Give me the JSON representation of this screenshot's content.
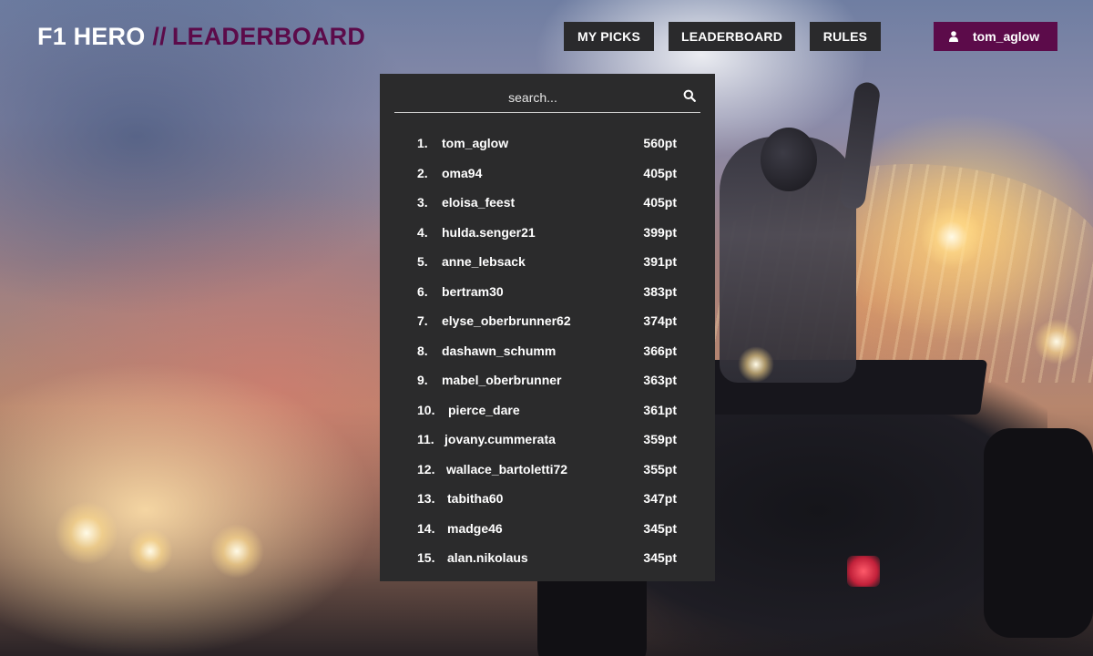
{
  "header": {
    "brand": "F1 HERO",
    "separator": "//",
    "page_title": "LEADERBOARD"
  },
  "nav": {
    "my_picks": "MY PICKS",
    "leaderboard": "LEADERBOARD",
    "rules": "RULES"
  },
  "user": {
    "icon": "user-icon",
    "name": "tom_aglow"
  },
  "colors": {
    "accent": "#5c0b4a",
    "panel": "#2b2b2c",
    "nav_button": "#2a2a2c"
  },
  "search": {
    "placeholder": "search...",
    "icon": "search-icon"
  },
  "leaderboard": {
    "entries": [
      {
        "rank": "1.",
        "name": "tom_aglow",
        "points": "560pt"
      },
      {
        "rank": "2.",
        "name": "oma94",
        "points": "405pt"
      },
      {
        "rank": "3.",
        "name": "eloisa_feest",
        "points": "405pt"
      },
      {
        "rank": "4.",
        "name": "hulda.senger21",
        "points": "399pt"
      },
      {
        "rank": "5.",
        "name": "anne_lebsack",
        "points": "391pt"
      },
      {
        "rank": "6.",
        "name": "bertram30",
        "points": "383pt"
      },
      {
        "rank": "7.",
        "name": "elyse_oberbrunner62",
        "points": "374pt"
      },
      {
        "rank": "8.",
        "name": "dashawn_schumm",
        "points": "366pt"
      },
      {
        "rank": "9.",
        "name": "mabel_oberbrunner",
        "points": "363pt"
      },
      {
        "rank": "10.",
        "name": "pierce_dare",
        "points": "361pt"
      },
      {
        "rank": "11.",
        "name": "jovany.cummerata",
        "points": "359pt"
      },
      {
        "rank": "12.",
        "name": "wallace_bartoletti72",
        "points": "355pt"
      },
      {
        "rank": "13.",
        "name": "tabitha60",
        "points": "347pt"
      },
      {
        "rank": "14.",
        "name": "madge46",
        "points": "345pt"
      },
      {
        "rank": "15.",
        "name": "alan.nikolaus",
        "points": "345pt"
      }
    ]
  }
}
